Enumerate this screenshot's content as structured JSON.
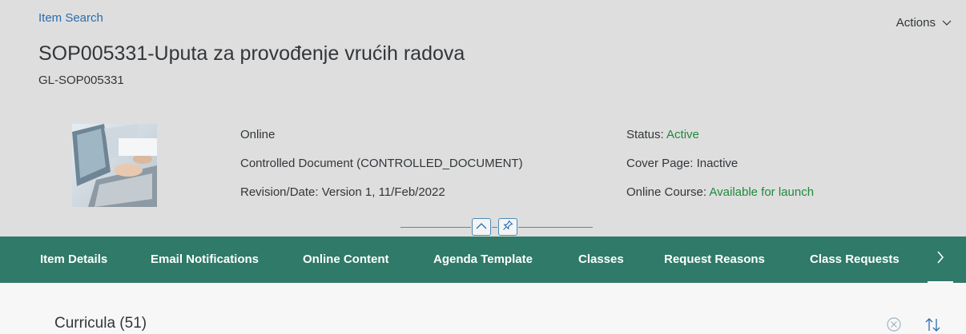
{
  "header": {
    "breadcrumb": "Item Search",
    "actions_label": "Actions",
    "title": "SOP005331-Uputa za provođenje vrućih radova",
    "subtitle": "GL-SOP005331"
  },
  "details": {
    "left": {
      "delivery": "Online",
      "type": "Controlled Document (CONTROLLED_DOCUMENT)",
      "revision": "Revision/Date: Version 1, 11/Feb/2022"
    },
    "right": {
      "status_label": "Status:",
      "status_value": "Active",
      "cover_label": "Cover Page:",
      "cover_value": "Inactive",
      "course_label": "Online Course:",
      "course_value": "Available for launch"
    }
  },
  "tabs": [
    {
      "label": "Item Details"
    },
    {
      "label": "Email Notifications"
    },
    {
      "label": "Online Content"
    },
    {
      "label": "Agenda Template"
    },
    {
      "label": "Classes"
    },
    {
      "label": "Request Reasons"
    },
    {
      "label": "Class Requests"
    }
  ],
  "section": {
    "title": "Curricula (51)"
  },
  "colors": {
    "header_bg": "#dedede",
    "tabbar_bg": "#2f7a68",
    "link": "#2a6cb0",
    "positive": "#1e8a3c"
  },
  "icons": [
    "chevron-down-icon",
    "collapse-header-icon",
    "pin-icon",
    "chevron-right-icon",
    "clear-icon",
    "sort-icon"
  ]
}
